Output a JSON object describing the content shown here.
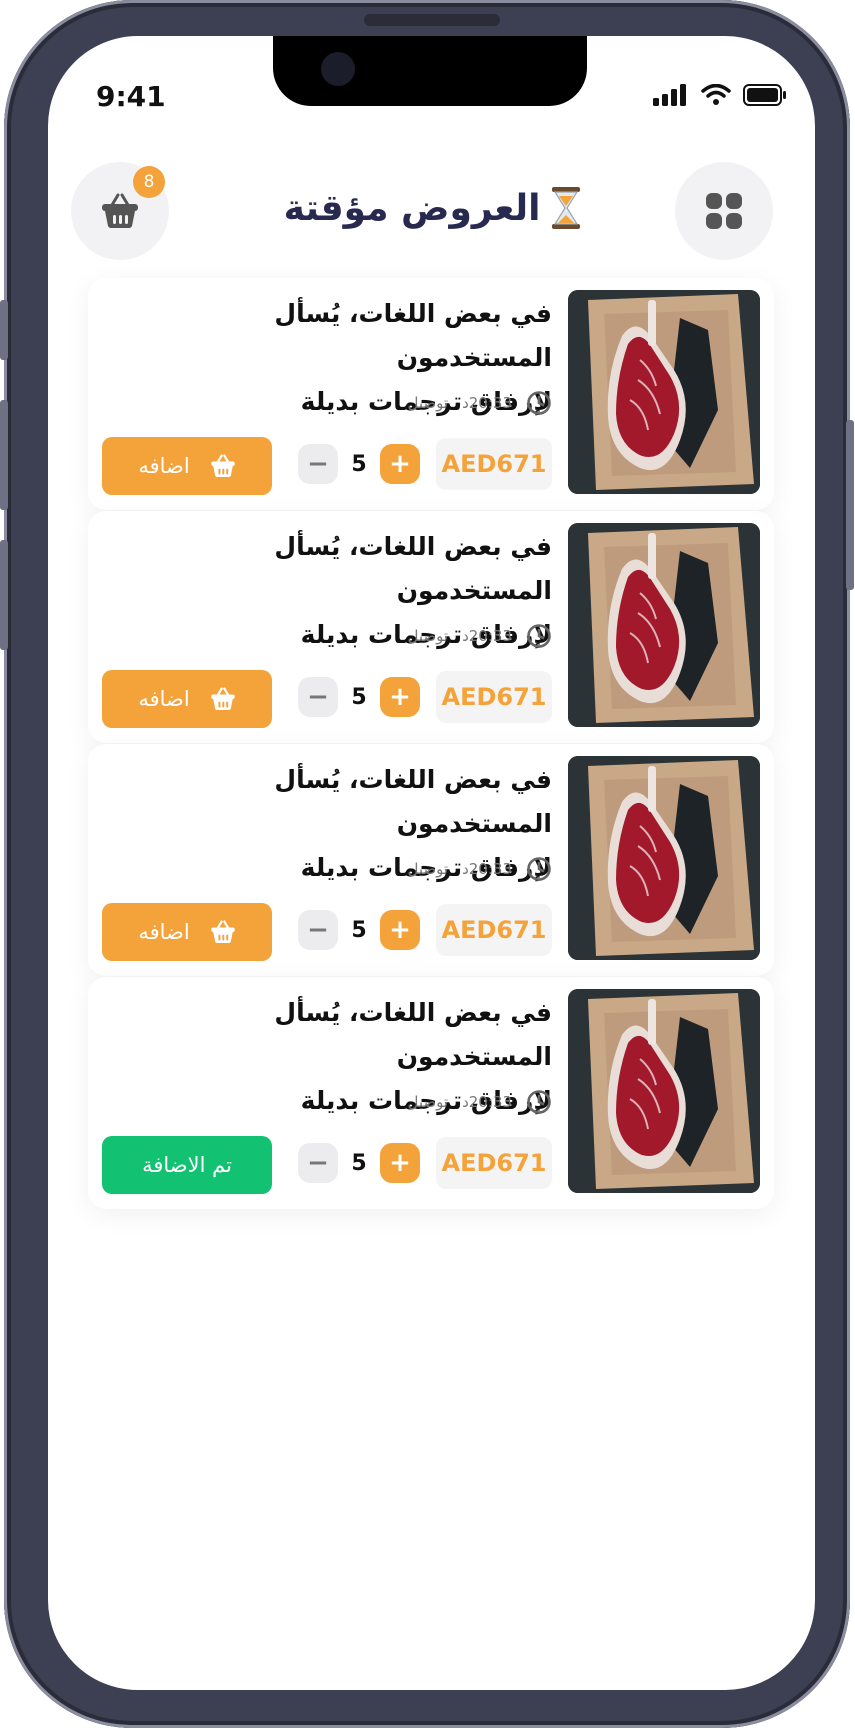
{
  "status_bar": {
    "time": "9:41"
  },
  "header": {
    "title": "العروض مؤقتة",
    "title_icon": "hourglass-icon",
    "cart_icon": "basket-icon",
    "cart_count": "8",
    "menu_icon": "grid-icon"
  },
  "colors": {
    "accent": "#f4a23a",
    "added": "#12c172",
    "title": "#27294f"
  },
  "products": [
    {
      "title_line1": "في بعض اللغات، يُسأل المستخدمون",
      "title_line2": "لإرفاق ترجمات بديلة",
      "delivery_label": "توصيل",
      "delivery_time": "20:33د",
      "price": "AED671",
      "quantity": "5",
      "button_label": "اضافه",
      "added": false
    },
    {
      "title_line1": "في بعض اللغات، يُسأل المستخدمون",
      "title_line2": "لإرفاق ترجمات بديلة",
      "delivery_label": "توصيل",
      "delivery_time": "20:33د",
      "price": "AED671",
      "quantity": "5",
      "button_label": "اضافه",
      "added": false
    },
    {
      "title_line1": "في بعض اللغات، يُسأل المستخدمون",
      "title_line2": "لإرفاق ترجمات بديلة",
      "delivery_label": "توصيل",
      "delivery_time": "20:33د",
      "price": "AED671",
      "quantity": "5",
      "button_label": "اضافه",
      "added": false
    },
    {
      "title_line1": "في بعض اللغات، يُسأل المستخدمون",
      "title_line2": "لإرفاق ترجمات بديلة",
      "delivery_label": "توصيل",
      "delivery_time": "20:33د",
      "price": "AED671",
      "quantity": "5",
      "button_label": "تم الاضافة",
      "added": true
    }
  ]
}
